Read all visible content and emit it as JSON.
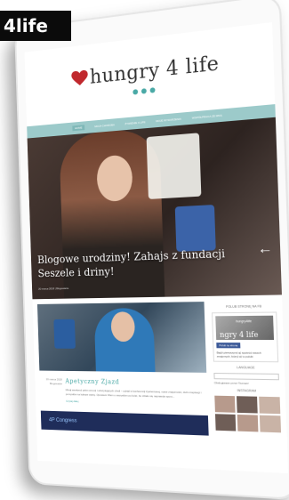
{
  "tag": {
    "label": "4life"
  },
  "site": {
    "logo_text": "hungry 4 life",
    "brand_color": "#4aa9a6",
    "nav": {
      "items": [
        "HOME",
        "MOJA CHOROBA",
        "ŻYWIENIE 4 LIFE",
        "MOJE WYDARZENIA",
        "WSPÓŁPRACA ZE MNĄ"
      ]
    },
    "hero": {
      "title": "Blogowe urodziny! Zahajs z fundacji Seszele i driny!",
      "meta": "20 marca 2018   |   Blogowanie"
    },
    "post": {
      "date": "20 marca 2018",
      "category": "Blogowanie",
      "title": "Apetyczny Zjazd",
      "excerpt": "Minął weekend pełen emocji i ekscytujących chwil – udział w konferencji żywieniowej, nowe znajomości, dużo inspiracji i pomysłów na kolejne wpisy. Opowiem Wam o wszystkim po kolei, bo działo się naprawdę sporo...",
      "more": "Czytaj dalej"
    },
    "banner": {
      "text": "4P Congress"
    },
    "sidebar": {
      "fb_title": "POLUB STRONĘ NA FB",
      "fb_page_name": "hungry4life",
      "fb_cover_text": "ngry 4 life",
      "fb_like": "Polub tę stronę",
      "fb_text": "Bądź pierwszym(-ą) spośród swoich znajomych, który(-a) to polubi",
      "lang_title": "LANGUAGE",
      "lang_value": "",
      "lang_note": "Obsługiwane przez Tłumacz",
      "insta_title": "INSTAGRAM"
    }
  }
}
